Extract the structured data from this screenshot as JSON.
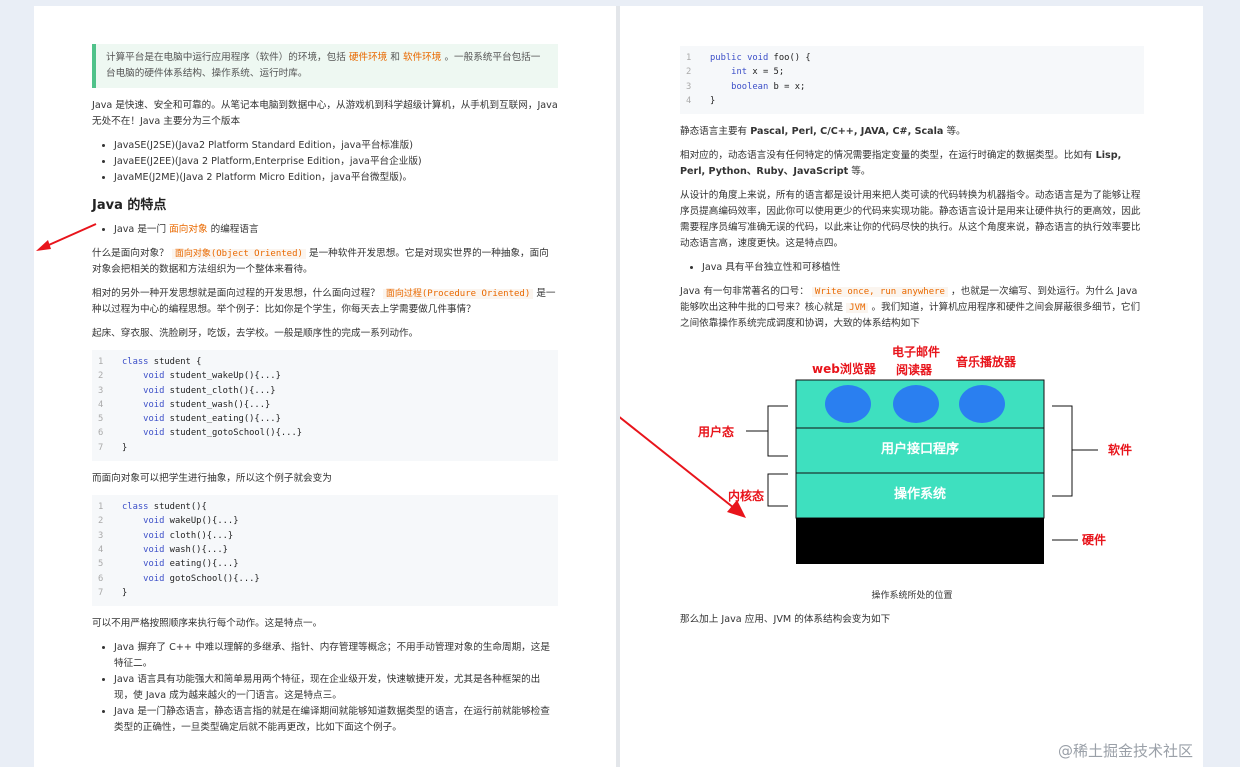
{
  "left": {
    "quote": {
      "pre": "计算平台是在电脑中运行应用程序（软件）的环境，包括",
      "hl1": "硬件环境",
      "mid": "和",
      "hl2": "软件环境",
      "post": "。一般系统平台包括一台电脑的硬件体系结构、操作系统、运行时库。"
    },
    "intro": "Java 是快速、安全和可靠的。从笔记本电脑到数据中心，从游戏机到科学超级计算机，从手机到互联网，Java 无处不在！Java 主要分为三个版本",
    "editions": [
      "JavaSE(J2SE)(Java2 Platform Standard Edition，java平台标准版)",
      "JavaEE(J2EE)(Java 2 Platform,Enterprise Edition，java平台企业版)",
      "JavaME(J2ME)(Java 2 Platform Micro Edition，java平台微型版)。"
    ],
    "heading": "Java 的特点",
    "feature1": {
      "pre": "Java 是一门",
      "hl": "面向对象",
      "post": "的编程语言"
    },
    "oop_para": {
      "pre": "什么是面向对象？",
      "code": "面向对象(Object Oriented)",
      "post": "是一种软件开发思想。它是对现实世界的一种抽象，面向对象会把相关的数据和方法组织为一个整体来看待。"
    },
    "pop_para": {
      "pre": "相对的另外一种开发思想就是面向过程的开发思想，什么面向过程？",
      "code": "面向过程(Procedure Oriented)",
      "post": "是一种以过程为中心的编程思想。举个例子：比如你是个学生，你每天去上学需要做几件事情？"
    },
    "routine": "起床、穿衣服、洗脸刷牙，吃饭，去学校。一般是顺序性的完成一系列动作。",
    "code1": [
      {
        "n": "1",
        "kw": "class",
        "rest": " student {"
      },
      {
        "n": "2",
        "kw": "    void",
        "rest": " student_wakeUp(){...}"
      },
      {
        "n": "3",
        "kw": "    void",
        "rest": " student_cloth(){...}"
      },
      {
        "n": "4",
        "kw": "    void",
        "rest": " student_wash(){...}"
      },
      {
        "n": "5",
        "kw": "    void",
        "rest": " student_eating(){...}"
      },
      {
        "n": "6",
        "kw": "    void",
        "rest": " student_gotoSchool(){...}"
      },
      {
        "n": "7",
        "kw": "",
        "rest": "}"
      }
    ],
    "abstract_para": "而面向对象可以把学生进行抽象，所以这个例子就会变为",
    "code2": [
      {
        "n": "1",
        "kw": "class",
        "rest": " student(){"
      },
      {
        "n": "2",
        "kw": "    void",
        "rest": " wakeUp(){...}"
      },
      {
        "n": "3",
        "kw": "    void",
        "rest": " cloth(){...}"
      },
      {
        "n": "4",
        "kw": "    void",
        "rest": " wash(){...}"
      },
      {
        "n": "5",
        "kw": "    void",
        "rest": " eating(){...}"
      },
      {
        "n": "6",
        "kw": "    void",
        "rest": " gotoSchool(){...}"
      },
      {
        "n": "7",
        "kw": "",
        "rest": "}"
      }
    ],
    "feature_one": "可以不用严格按照顺序来执行每个动作。这是特点一。",
    "features": [
      "Java 摒弃了 C++ 中难以理解的多继承、指针、内存管理等概念；不用手动管理对象的生命周期，这是特征二。",
      "Java 语言具有功能强大和简单易用两个特征，现在企业级开发，快速敏捷开发，尤其是各种框架的出现，使 Java 成为越来越火的一门语言。这是特点三。",
      "Java 是一门静态语言，静态语言指的就是在编译期间就能够知道数据类型的语言，在运行前就能够检查类型的正确性，一旦类型确定后就不能再更改，比如下面这个例子。"
    ]
  },
  "right": {
    "code3": [
      {
        "n": "1",
        "kw": "public void",
        "rest": " foo() {"
      },
      {
        "n": "2",
        "kw": "    int",
        "rest": " x = 5;"
      },
      {
        "n": "3",
        "kw": "    boolean",
        "rest": " b = x;"
      },
      {
        "n": "4",
        "kw": "",
        "rest": "}"
      }
    ],
    "static_langs": {
      "pre": "静态语言主要有",
      "bold": "Pascal, Perl, C/C++, JAVA, C#, Scala",
      "post": "等。"
    },
    "dynamic_para": {
      "pre": "相对应的，动态语言没有任何特定的情况需要指定变量的类型，在运行时确定的数据类型。比如有",
      "bold": "Lisp, Perl, Python、Ruby、JavaScript",
      "post": "等。"
    },
    "design_para": "从设计的角度上来说，所有的语言都是设计用来把人类可读的代码转换为机器指令。动态语言是为了能够让程序员提高编码效率，因此你可以使用更少的代码来实现功能。静态语言设计是用来让硬件执行的更高效，因此需要程序员编写准确无误的代码，以此来让你的代码尽快的执行。从这个角度来说，静态语言的执行效率要比动态语言高，速度更快。这是特点四。",
    "platform_item": "Java 具有平台独立性和可移植性",
    "slogan_para": {
      "pre": "Java 有一句非常著名的口号：",
      "code1": "Write once, run anywhere",
      "mid": "，也就是一次编写、到处运行。为什么 Java 能够吹出这种牛批的口号来？核心就是",
      "code2": "JVM",
      "post": "。我们知道，计算机应用程序和硬件之间会屏蔽很多细节，它们之间依靠操作系统完成调度和协调，大致的体系结构如下"
    },
    "diagram": {
      "apps": [
        "web浏览器",
        "电子邮件",
        "阅读器",
        "音乐播放器"
      ],
      "user_api": "用户接口程序",
      "os": "操作系统",
      "user_mode": "用户态",
      "kernel_mode": "内核态",
      "software": "软件",
      "hardware": "硬件",
      "label_color": "#e8141b",
      "box_color": "#3ee0bf",
      "bubble_color": "#2a7ff0"
    },
    "caption": "操作系统所处的位置",
    "final_para": "那么加上 Java 应用、JVM 的体系结构会变为如下"
  },
  "watermark": "@稀土掘金技术社区"
}
